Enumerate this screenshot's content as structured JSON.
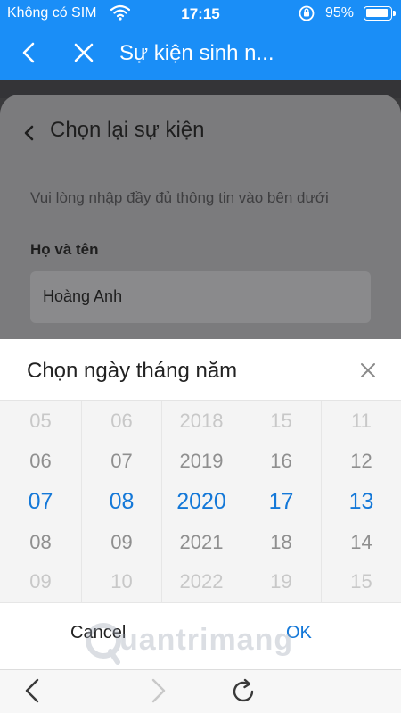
{
  "status_bar": {
    "carrier": "Không có SIM",
    "time": "17:15",
    "battery": "95%"
  },
  "header": {
    "title": "Sự kiện sinh n...",
    "icons": [
      "back-chevron-icon",
      "close-icon"
    ]
  },
  "form": {
    "back_label": "Chọn lại sự kiện",
    "hint": "Vui lòng nhập đầy đủ thông tin vào bên dưới",
    "name_label": "Họ và tên",
    "name_value": "Hoàng Anh"
  },
  "date_picker": {
    "title": "Chọn ngày tháng năm",
    "columns": [
      [
        "05",
        "06",
        "07",
        "08",
        "09"
      ],
      [
        "06",
        "07",
        "08",
        "09",
        "10"
      ],
      [
        "2018",
        "2019",
        "2020",
        "2021",
        "2022"
      ],
      [
        "15",
        "16",
        "17",
        "18",
        "19"
      ],
      [
        "11",
        "12",
        "13",
        "14",
        "15"
      ]
    ],
    "selected": [
      "07",
      "08",
      "2020",
      "17",
      "13"
    ],
    "cancel_label": "Cancel",
    "ok_label": "OK",
    "accent_color": "#1478d8"
  },
  "watermark": "uantrimang",
  "theme": {
    "header_color": "#1a8ef7"
  }
}
